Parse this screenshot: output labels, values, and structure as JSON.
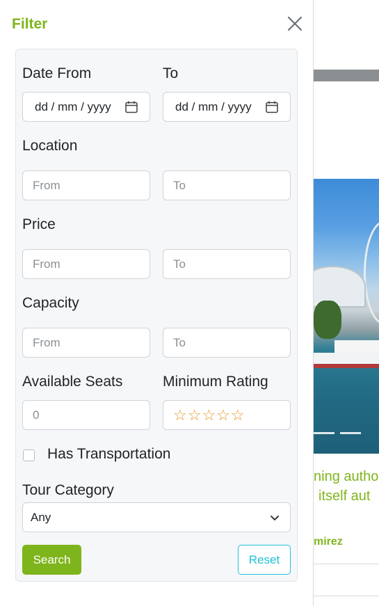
{
  "background": {
    "text_line_1": "ning autho",
    "text_line_2": "itself aut",
    "author": "mirez"
  },
  "drawer": {
    "title": "Filter",
    "close_icon": "close-icon"
  },
  "filters": {
    "date_from": {
      "label": "Date From",
      "placeholder": "dd / mm / yyyy",
      "icon": "calendar-icon"
    },
    "date_to": {
      "label": "To",
      "placeholder": "dd / mm / yyyy",
      "icon": "calendar-icon"
    },
    "location": {
      "label": "Location",
      "from_placeholder": "From",
      "to_placeholder": "To"
    },
    "price": {
      "label": "Price",
      "from_placeholder": "From",
      "to_placeholder": "To"
    },
    "capacity": {
      "label": "Capacity",
      "from_placeholder": "From",
      "to_placeholder": "To"
    },
    "available_seats": {
      "label": "Available Seats",
      "placeholder": "0"
    },
    "minimum_rating": {
      "label": "Minimum Rating",
      "stars": "☆☆☆☆☆",
      "value": 0,
      "max": 5
    },
    "has_transportation": {
      "label": "Has Transportation",
      "checked": false
    },
    "tour_category": {
      "label": "Tour Category",
      "selected": "Any",
      "icon": "chevron-down-icon"
    }
  },
  "actions": {
    "search_label": "Search",
    "reset_label": "Reset"
  },
  "colors": {
    "accent_green": "#7fb51c",
    "reset_cyan": "#1fc0d8",
    "star_orange": "#e79a32"
  }
}
